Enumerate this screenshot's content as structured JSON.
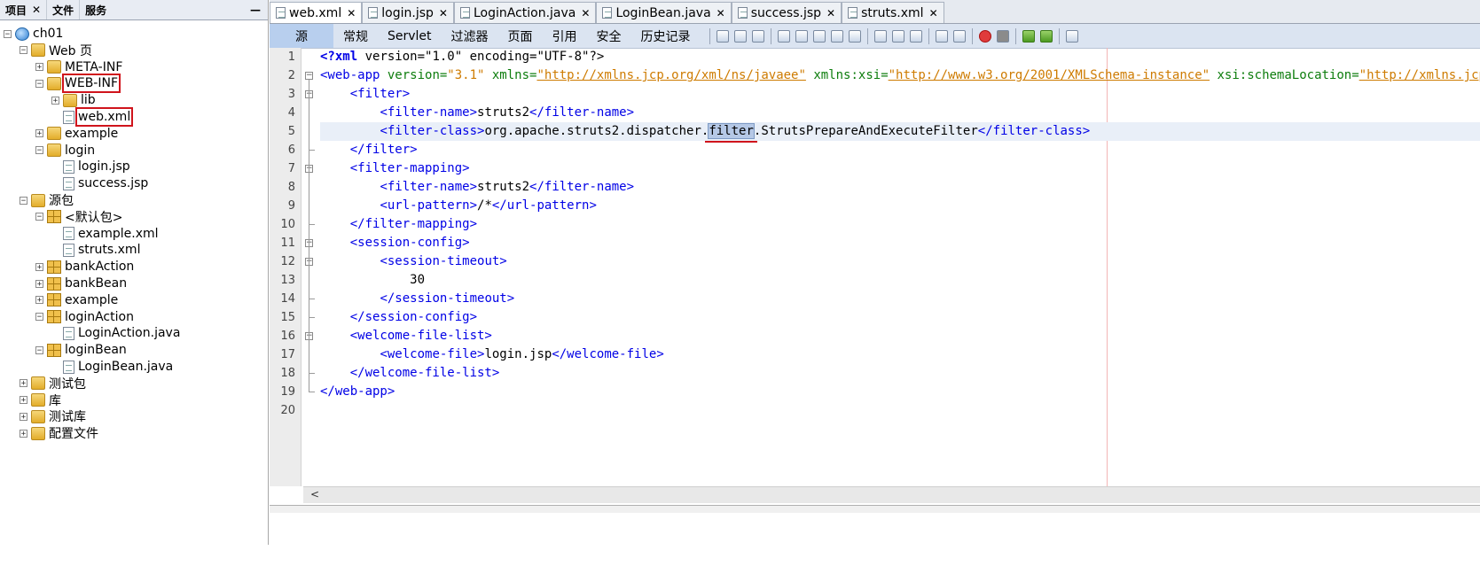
{
  "left_panel": {
    "tabs": [
      {
        "label": "项目",
        "close": "✕"
      },
      {
        "label": "文件"
      },
      {
        "label": "服务"
      }
    ],
    "minimize": "—",
    "tree": [
      {
        "label": "ch01",
        "icon": "globe-icon",
        "toggle": "−"
      },
      {
        "label": "Web 页",
        "icon": "folder-icon",
        "toggle": "−"
      },
      {
        "label": "META-INF",
        "icon": "folder-icon",
        "toggle": "+"
      },
      {
        "label": "WEB-INF",
        "icon": "folder-icon",
        "toggle": "−"
      },
      {
        "label": "lib",
        "icon": "folder-icon",
        "toggle": "+"
      },
      {
        "label": "web.xml",
        "icon": "xml-file-icon"
      },
      {
        "label": "example",
        "icon": "folder-icon",
        "toggle": "+"
      },
      {
        "label": "login",
        "icon": "folder-icon",
        "toggle": "−"
      },
      {
        "label": "login.jsp",
        "icon": "jsp-file-icon"
      },
      {
        "label": "success.jsp",
        "icon": "jsp-file-icon"
      },
      {
        "label": "源包",
        "icon": "folder-icon",
        "toggle": "−"
      },
      {
        "label": "<默认包>",
        "icon": "package-icon",
        "toggle": "−"
      },
      {
        "label": "example.xml",
        "icon": "xml-file-icon"
      },
      {
        "label": "struts.xml",
        "icon": "xml-file-icon"
      },
      {
        "label": "bankAction",
        "icon": "package-icon",
        "toggle": "+"
      },
      {
        "label": "bankBean",
        "icon": "package-icon",
        "toggle": "+"
      },
      {
        "label": "example",
        "icon": "package-icon",
        "toggle": "+"
      },
      {
        "label": "loginAction",
        "icon": "package-icon",
        "toggle": "−"
      },
      {
        "label": "LoginAction.java",
        "icon": "java-file-icon"
      },
      {
        "label": "loginBean",
        "icon": "package-icon",
        "toggle": "−"
      },
      {
        "label": "LoginBean.java",
        "icon": "java-file-icon"
      },
      {
        "label": "测试包",
        "icon": "folder-icon",
        "toggle": "+"
      },
      {
        "label": "库",
        "icon": "library-icon",
        "toggle": "+"
      },
      {
        "label": "测试库",
        "icon": "folder-icon",
        "toggle": "+"
      },
      {
        "label": "配置文件",
        "icon": "folder-icon",
        "toggle": "+"
      }
    ]
  },
  "editor": {
    "tabs": [
      {
        "label": "web.xml",
        "close": "✕"
      },
      {
        "label": "login.jsp",
        "close": "✕"
      },
      {
        "label": "LoginAction.java",
        "close": "✕"
      },
      {
        "label": "LoginBean.java",
        "close": "✕"
      },
      {
        "label": "success.jsp",
        "close": "✕"
      },
      {
        "label": "struts.xml",
        "close": "✕"
      }
    ],
    "view_tabs": [
      "源",
      "常规",
      "Servlet",
      "过滤器",
      "页面",
      "引用",
      "安全",
      "历史记录"
    ],
    "line_numbers": [
      "1",
      "2",
      "3",
      "4",
      "5",
      "6",
      "7",
      "8",
      "9",
      "10",
      "11",
      "12",
      "13",
      "14",
      "15",
      "16",
      "17",
      "18",
      "19",
      "20"
    ],
    "code": {
      "l1": {
        "pi_open": "<?xml",
        "rest": " version=\"1.0\" encoding=\"UTF-8\"?>"
      },
      "l2": {
        "tag_open": "<web-app",
        "a1": " version=",
        "v1": "\"3.1\"",
        "a2": " xmlns=",
        "v2": "\"http://xmlns.jcp.org/xml/ns/javaee\"",
        "a3": " xmlns:xsi=",
        "v3": "\"http://www.w3.org/2001/XMLSchema-instance\"",
        "a4": " xsi:schemaLocation=",
        "v4": "\"http://xmlns.jcp.org/xm"
      },
      "l3": "<filter>",
      "l4": {
        "open": "<filter-name>",
        "text": "struts2",
        "close": "</filter-name>"
      },
      "l5": {
        "open": "<filter-class>",
        "text_a": "org.apache.struts2.dispatcher",
        "dot1": ".",
        "sel": "filter",
        "dot2": ".",
        "text_b": "StrutsPrepareAndExecuteFilter",
        "close": "</filter-class>"
      },
      "l6": "</filter>",
      "l7": "<filter-mapping>",
      "l8": {
        "open": "<filter-name>",
        "text": "struts2",
        "close": "</filter-name>"
      },
      "l9": {
        "open": "<url-pattern>",
        "text": "/*",
        "close": "</url-pattern>"
      },
      "l10": "</filter-mapping>",
      "l11": "<session-config>",
      "l12": "<session-timeout>",
      "l13": "30",
      "l14": "</session-timeout>",
      "l15": "</session-config>",
      "l16": "<welcome-file-list>",
      "l17": {
        "open": "<welcome-file>",
        "text": "login.jsp",
        "close": "</welcome-file>"
      },
      "l18": "</welcome-file-list>",
      "l19": "</web-app>"
    },
    "scroll_left": "<"
  },
  "colors": {
    "tag": "#0000e6",
    "attr": "#0d7d0d",
    "value": "#ce7b00",
    "highlight": "#d0141c"
  }
}
